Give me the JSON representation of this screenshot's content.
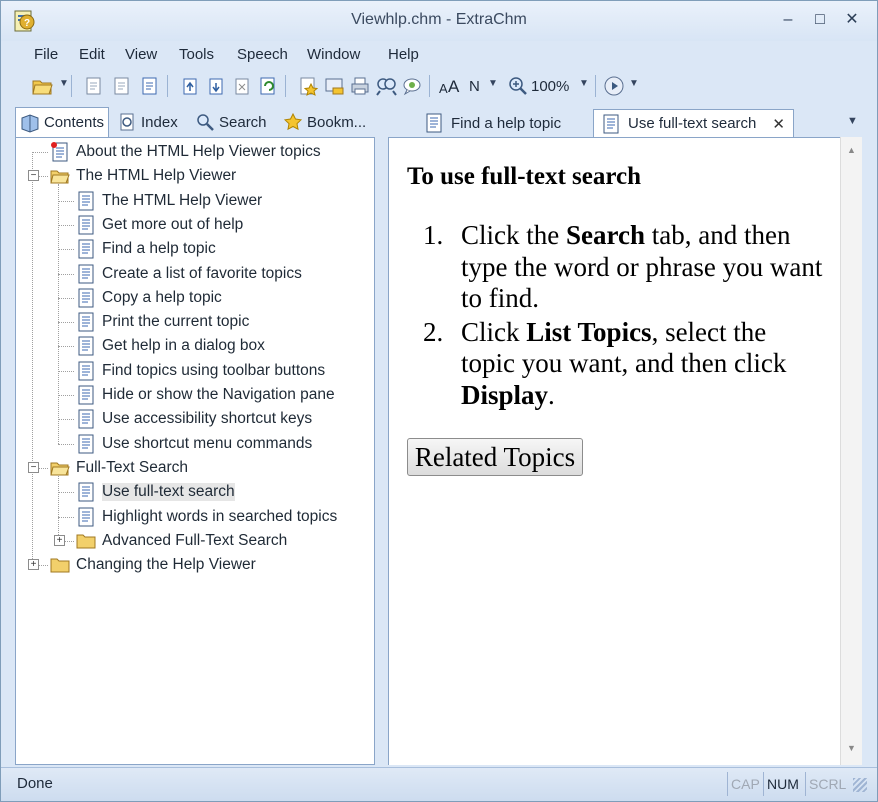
{
  "window": {
    "title": "Viewhlp.chm - ExtraChm",
    "controls": {
      "minimize": "‒",
      "maximize": "□",
      "close": "✕"
    }
  },
  "menu": [
    "File",
    "Edit",
    "View",
    "Tools",
    "Speech",
    "Window",
    "Help"
  ],
  "toolbar": {
    "font_label": "A",
    "font_label_2": "A",
    "n_label": "N",
    "zoom": "100%"
  },
  "nav_tabs": [
    {
      "label": "Contents",
      "icon": "book-icon",
      "active": true
    },
    {
      "label": "Index",
      "icon": "index-icon",
      "active": false
    },
    {
      "label": "Search",
      "icon": "magnifier-icon",
      "active": false
    },
    {
      "label": "Bookm...",
      "icon": "star-icon",
      "active": false
    }
  ],
  "tree": [
    {
      "label": "About the HTML Help Viewer topics",
      "type": "page-special",
      "level": 0
    },
    {
      "label": "The HTML Help Viewer",
      "type": "folder-open",
      "level": 0,
      "expanded": true
    },
    {
      "label": "The HTML Help Viewer",
      "type": "page",
      "level": 1
    },
    {
      "label": "Get more out of help",
      "type": "page",
      "level": 1
    },
    {
      "label": "Find a help topic",
      "type": "page",
      "level": 1
    },
    {
      "label": "Create a list of favorite topics",
      "type": "page",
      "level": 1
    },
    {
      "label": "Copy a help topic",
      "type": "page",
      "level": 1
    },
    {
      "label": "Print the current topic",
      "type": "page",
      "level": 1
    },
    {
      "label": "Get help in a dialog box",
      "type": "page",
      "level": 1
    },
    {
      "label": "Find topics using toolbar buttons",
      "type": "page",
      "level": 1
    },
    {
      "label": "Hide or show the Navigation pane",
      "type": "page",
      "level": 1
    },
    {
      "label": "Use accessibility shortcut keys",
      "type": "page",
      "level": 1
    },
    {
      "label": "Use shortcut menu commands",
      "type": "page",
      "level": 1
    },
    {
      "label": "Full-Text Search",
      "type": "folder-open",
      "level": 0,
      "expanded": true
    },
    {
      "label": "Use full-text search",
      "type": "page",
      "level": 1,
      "selected": true
    },
    {
      "label": "Highlight words in searched topics",
      "type": "page",
      "level": 1
    },
    {
      "label": "Advanced Full-Text Search",
      "type": "folder",
      "level": 1,
      "collapsed": true
    },
    {
      "label": "Changing the Help Viewer",
      "type": "folder",
      "level": 0,
      "collapsed": true
    }
  ],
  "content_tabs": [
    {
      "label": "Find a help topic",
      "active": false
    },
    {
      "label": "Use full-text search",
      "active": true,
      "close": "✕"
    }
  ],
  "content": {
    "heading": "To use full-text search",
    "steps": [
      {
        "num": "1.",
        "parts": [
          {
            "t": "Click the ",
            "b": false
          },
          {
            "t": "Search",
            "b": true
          },
          {
            "t": " tab, and then type the word or phrase you want to find.",
            "b": false
          }
        ]
      },
      {
        "num": "2.",
        "parts": [
          {
            "t": "Click ",
            "b": false
          },
          {
            "t": "List Topics",
            "b": true
          },
          {
            "t": ", select the topic you want, and then click ",
            "b": false
          },
          {
            "t": "Display",
            "b": true
          },
          {
            "t": ".",
            "b": false
          }
        ]
      }
    ],
    "related_button": "Related Topics"
  },
  "status": {
    "text": "Done",
    "indicators": [
      "CAP",
      "NUM",
      "SCRL"
    ]
  }
}
